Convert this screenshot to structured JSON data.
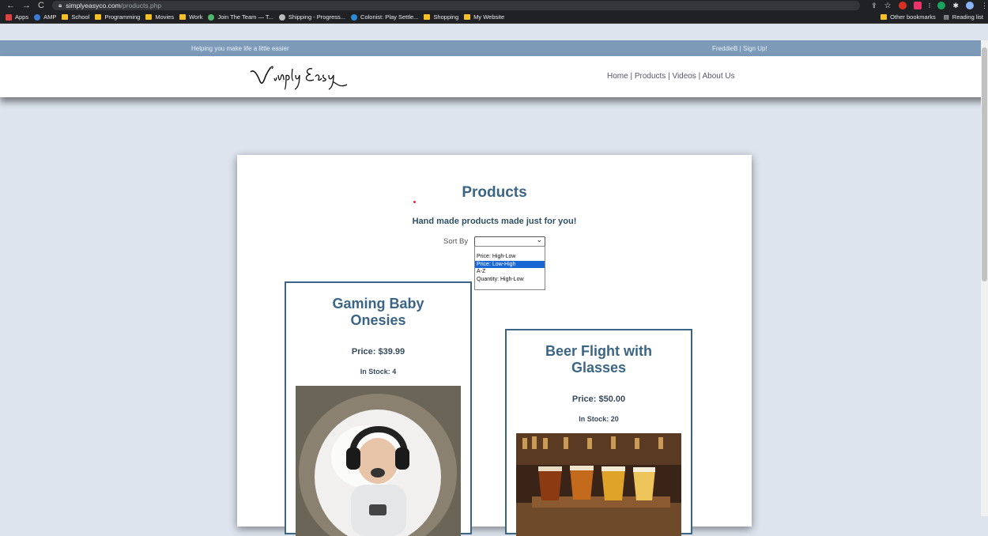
{
  "browser": {
    "url_domain": "simplyeasyco.com",
    "url_path": "/products.php",
    "bookmarks": [
      {
        "label": "Apps",
        "icon": "apps-grid-icon"
      },
      {
        "label": "AMP",
        "icon": "amp-icon"
      },
      {
        "label": "School",
        "icon": "folder-icon"
      },
      {
        "label": "Programming",
        "icon": "folder-icon"
      },
      {
        "label": "Movies",
        "icon": "folder-icon"
      },
      {
        "label": "Work",
        "icon": "folder-icon"
      },
      {
        "label": "Join The Team — T...",
        "icon": "site-icon"
      },
      {
        "label": "Shipping - Progress...",
        "icon": "site-icon"
      },
      {
        "label": "Colonist: Play Settle...",
        "icon": "site-icon"
      },
      {
        "label": "Shopping",
        "icon": "folder-icon"
      },
      {
        "label": "My Website",
        "icon": "folder-icon"
      }
    ],
    "other_bookmarks": "Other bookmarks",
    "reading_list": "Reading list"
  },
  "site": {
    "tagline": "Helping you make life a little easier",
    "user_links": "FreddieB | Sign Up!",
    "nav": [
      "Home",
      "Products",
      "Videos",
      "About Us"
    ],
    "nav_separator": " | "
  },
  "page": {
    "title": "Products",
    "subtitle": "Hand made products made just for you!",
    "sort_label": "Sort By",
    "sort_options": [
      "Price: High-Low",
      "Price: Low-High",
      "A-Z",
      "Quantity: High-Low"
    ],
    "sort_highlighted": "Price: Low-High"
  },
  "products": [
    {
      "name": "Gaming Baby Onesies",
      "price": "Price: $39.99",
      "stock": "In Stock: 4"
    },
    {
      "name": "Beer Flight with Glasses",
      "price": "Price: $50.00",
      "stock": "In Stock: 20"
    }
  ],
  "colors": {
    "accent": "#3b6584",
    "topbar": "#7d9ab9",
    "page_bg": "#dde4ee"
  }
}
